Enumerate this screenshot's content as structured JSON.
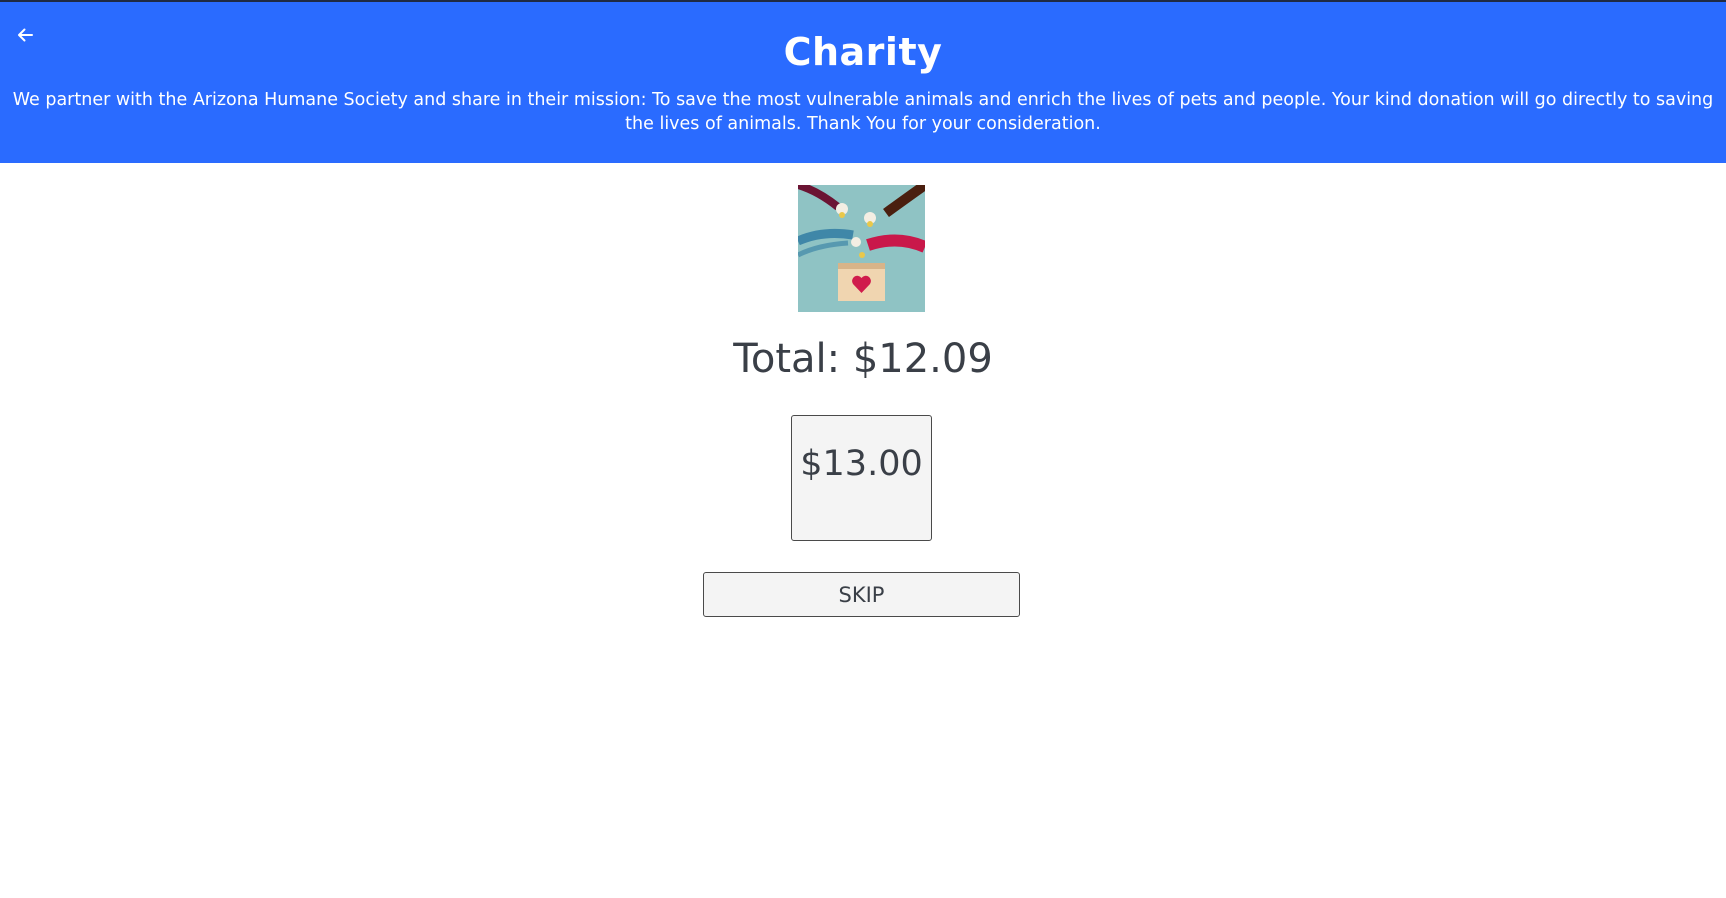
{
  "header": {
    "title": "Charity",
    "description": "We partner with the Arizona Humane Society and share in their mission: To save the most vulnerable animals and enrich the lives of pets and people. Your kind donation will go directly to saving the lives of animals. Thank You for your consideration.",
    "back_icon": "arrow-left-icon",
    "background": "#2a6bff"
  },
  "main": {
    "image_icon": "donation-box-illustration",
    "total_label": "Total: $12.09",
    "donation_option": "$13.00",
    "skip_label": "SKIP"
  }
}
